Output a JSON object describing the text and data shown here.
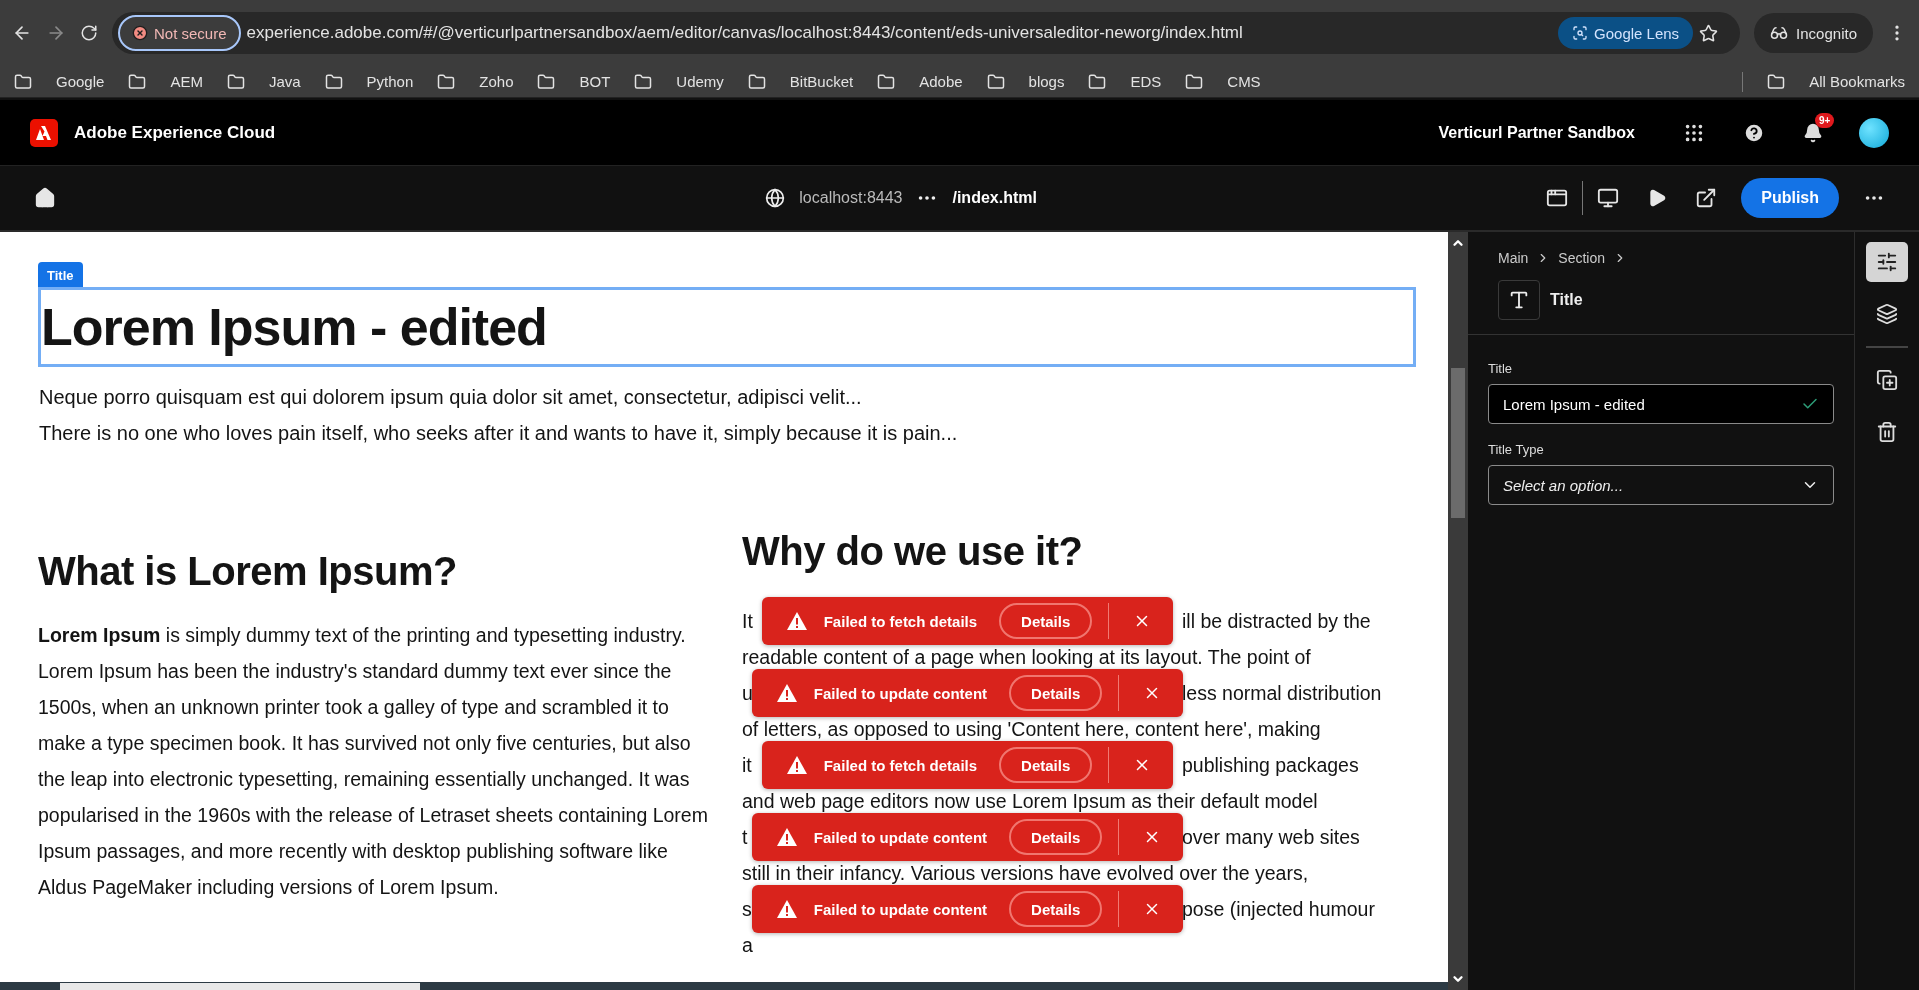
{
  "browser": {
    "security": "Not secure",
    "url": "experience.adobe.com/#/@verticurlpartnersandbox/aem/editor/canvas/localhost:8443/content/eds-universaleditor-neworg/index.html",
    "lens": "Google Lens",
    "profile": "Incognito",
    "bookmarks": [
      "Google",
      "AEM",
      "Java",
      "Python",
      "Zoho",
      "BOT",
      "Udemy",
      "BitBucket",
      "Adobe",
      "blogs",
      "EDS",
      "CMS"
    ],
    "all_bookmarks": "All Bookmarks"
  },
  "app_header": {
    "brand": "Adobe Experience Cloud",
    "org": "Verticurl Partner Sandbox",
    "notifications": "9+"
  },
  "toolbar": {
    "host": "localhost:8443",
    "path": "/index.html",
    "publish": "Publish"
  },
  "canvas": {
    "title_tag": "Title",
    "title": "Lorem Ipsum - edited",
    "intro": [
      "Neque porro quisquam est qui dolorem ipsum quia dolor sit amet, consectetur, adipisci velit...",
      "There is no one who loves pain itself, who seeks after it and wants to have it, simply because it is pain..."
    ],
    "left_section": {
      "heading": "What is Lorem Ipsum?",
      "body": "**Lorem Ipsum** is simply dummy text of the printing and typesetting industry. Lorem Ipsum has been the industry's standard dummy text ever since the 1500s, when an unknown printer took a galley of type and scrambled it to make a type specimen book. It has survived not only five centuries, but also the leap into electronic typesetting, remaining essentially unchanged. It was popularised in the 1960s with the release of Letraset sheets containing Lorem Ipsum passages, and more recently with desktop publishing software like Aldus PageMaker including versions of Lorem Ipsum."
    },
    "right_section": {
      "heading": "Why do we use it?",
      "lines": [
        {
          "kind": "split",
          "left": "It",
          "right": "ill be distracted by the"
        },
        {
          "kind": "full",
          "text": "readable content of a page when looking at its layout. The point of"
        },
        {
          "kind": "split",
          "left": "u",
          "right": "less normal distribution"
        },
        {
          "kind": "full",
          "text": "of letters, as opposed to using 'Content here, content here', making"
        },
        {
          "kind": "split",
          "left": "it",
          "right": "publishing packages"
        },
        {
          "kind": "full",
          "text": "and web page editors now use Lorem Ipsum as their default model"
        },
        {
          "kind": "split",
          "left": "t",
          "right": "over many web sites"
        },
        {
          "kind": "full",
          "text": "still in their infancy. Various versions have evolved over the years,"
        },
        {
          "kind": "split",
          "left": "s",
          "right": "pose (injected humour"
        },
        {
          "kind": "split",
          "left": "a"
        }
      ]
    }
  },
  "toasts": [
    {
      "message": "Failed to fetch details",
      "action": "Details"
    },
    {
      "message": "Failed to update content",
      "action": "Details"
    },
    {
      "message": "Failed to fetch details",
      "action": "Details"
    },
    {
      "message": "Failed to update content",
      "action": "Details"
    },
    {
      "message": "Failed to update content",
      "action": "Details"
    }
  ],
  "panel": {
    "breadcrumb": [
      "Main",
      "Section"
    ],
    "component": "Title",
    "fields": [
      {
        "kind": "text",
        "label": "Title",
        "value": "Lorem Ipsum - edited",
        "valid": true
      },
      {
        "kind": "select",
        "label": "Title Type",
        "placeholder": "Select an option..."
      }
    ]
  },
  "rail": [
    {
      "kind": "properties",
      "selected": true
    },
    {
      "kind": "layers",
      "selected": false
    },
    {
      "kind": "divider"
    },
    {
      "kind": "add",
      "selected": false
    },
    {
      "kind": "delete",
      "selected": false
    }
  ]
}
